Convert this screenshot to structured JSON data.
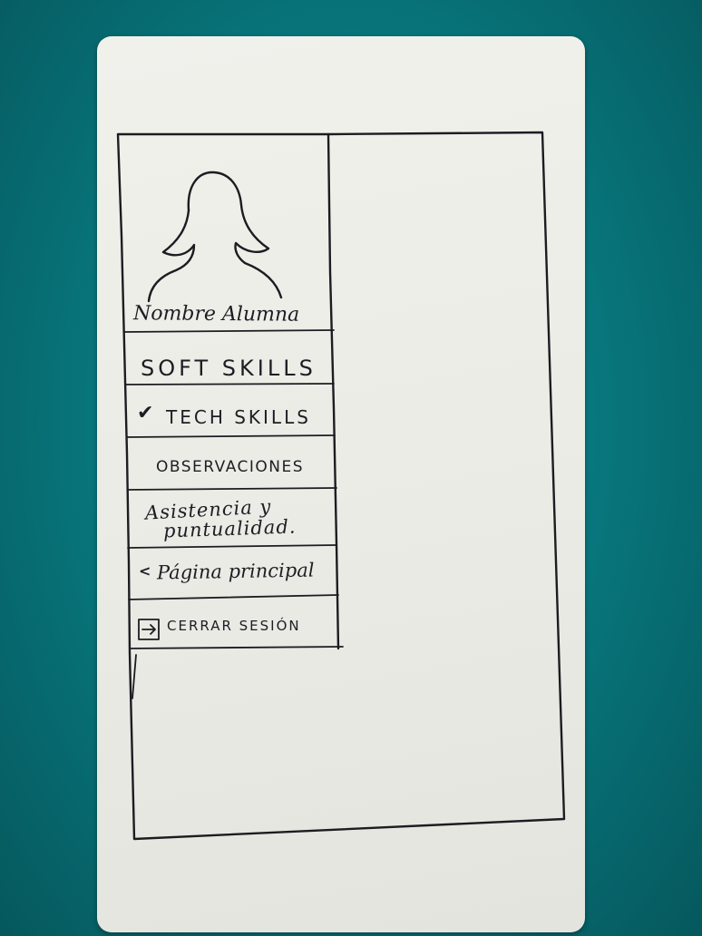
{
  "student": {
    "name": "Nombre Alumna"
  },
  "menu": {
    "items": [
      {
        "label": "SOFT SKILLS",
        "selected": false
      },
      {
        "label": "TECH SKILLS",
        "selected": true,
        "icon": "check-icon"
      },
      {
        "label": "OBSERVACIONES",
        "selected": false
      },
      {
        "label_line1": "Asistencia y",
        "label_line2": "puntualidad.",
        "selected": false
      },
      {
        "label": "Página principal",
        "icon": "chevron-left-icon"
      },
      {
        "label": "CERRAR SESIÓN",
        "icon": "logout-icon"
      }
    ]
  },
  "icons": {
    "check": "✔",
    "back": "<"
  },
  "colors": {
    "background": "#087a80",
    "paper": "#ebebe5",
    "ink": "#1c1c22"
  }
}
